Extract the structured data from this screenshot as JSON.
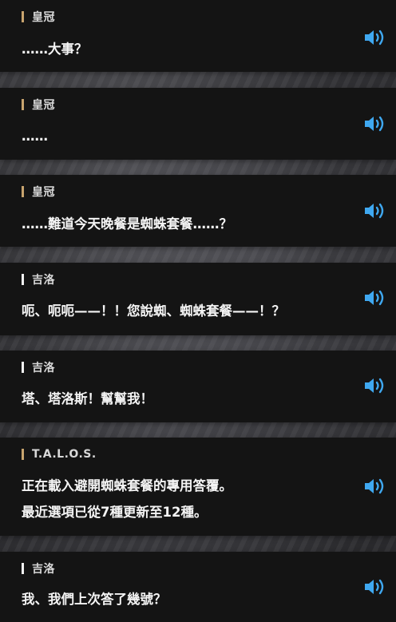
{
  "colors": {
    "accent_crown": "#c8a46e",
    "accent_default": "#f2f2f2",
    "voice_icon": "#3fa8f0",
    "panel_bg": "#141414"
  },
  "entries": [
    {
      "speaker": "皇冠",
      "lines": [
        "……大事？"
      ],
      "voice_icon": "speaker-icon"
    },
    {
      "speaker": "皇冠",
      "lines": [
        "……"
      ],
      "voice_icon": "speaker-icon"
    },
    {
      "speaker": "皇冠",
      "lines": [
        "……難道今天晚餐是蜘蛛套餐……？"
      ],
      "voice_icon": "speaker-icon"
    },
    {
      "speaker": "吉洛",
      "lines": [
        "呃、呃呃——！！您說蜘、蜘蛛套餐——！？"
      ],
      "voice_icon": "speaker-icon"
    },
    {
      "speaker": "吉洛",
      "lines": [
        "塔、塔洛斯！幫幫我！"
      ],
      "voice_icon": "speaker-icon"
    },
    {
      "speaker": "T.A.L.O.S.",
      "lines": [
        "正在載入避開蜘蛛套餐的專用答覆。",
        "最近選項已從7種更新至12種。"
      ],
      "voice_icon": "speaker-icon"
    },
    {
      "speaker": "吉洛",
      "lines": [
        "我、我們上次答了幾號？"
      ],
      "voice_icon": "speaker-icon"
    }
  ]
}
